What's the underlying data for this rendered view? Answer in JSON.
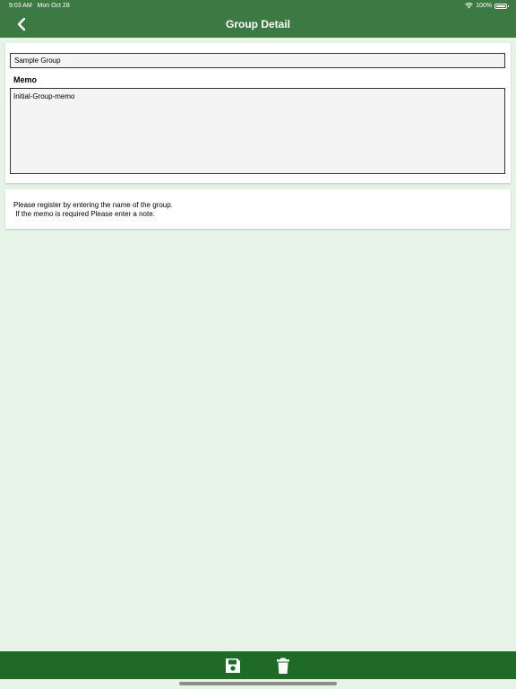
{
  "status_bar": {
    "time": "9:03 AM",
    "date": "Mon Oct 28",
    "battery": "100%"
  },
  "header": {
    "title": "Group Detail",
    "back_icon": "chevron-left-icon"
  },
  "form": {
    "name_value": "Sample Group",
    "memo_label": "Memo",
    "memo_value": "Initial-Group-memo"
  },
  "help": {
    "line1": "Please register by entering the name of the group.",
    "line2": " If the memo is required Please enter a note."
  },
  "toolbar": {
    "save_icon": "floppy-disk-icon",
    "delete_icon": "trash-icon"
  },
  "colors": {
    "header_bg": "#3d7a43",
    "toolbar_bg": "#1f6a26",
    "page_bg": "#e6f4e8"
  }
}
